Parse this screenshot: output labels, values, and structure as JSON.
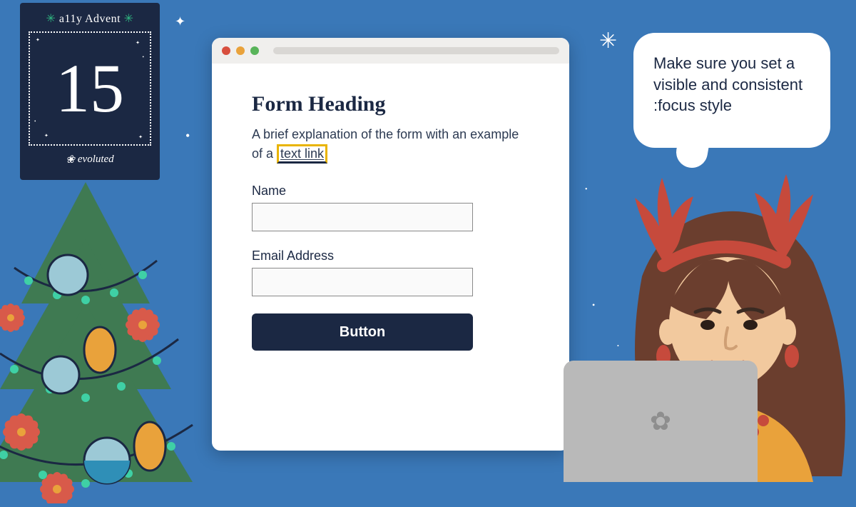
{
  "advent": {
    "title": "a11y Advent",
    "day": "15",
    "brand": "evoluted"
  },
  "form": {
    "heading": "Form Heading",
    "desc_pre": "A brief explanation of the form with an example of a ",
    "link_text": "text link",
    "labels": {
      "name": "Name",
      "email": "Email Address"
    },
    "button": "Button"
  },
  "bubble": {
    "text": "Make sure you set a visible and consistent :focus style"
  }
}
